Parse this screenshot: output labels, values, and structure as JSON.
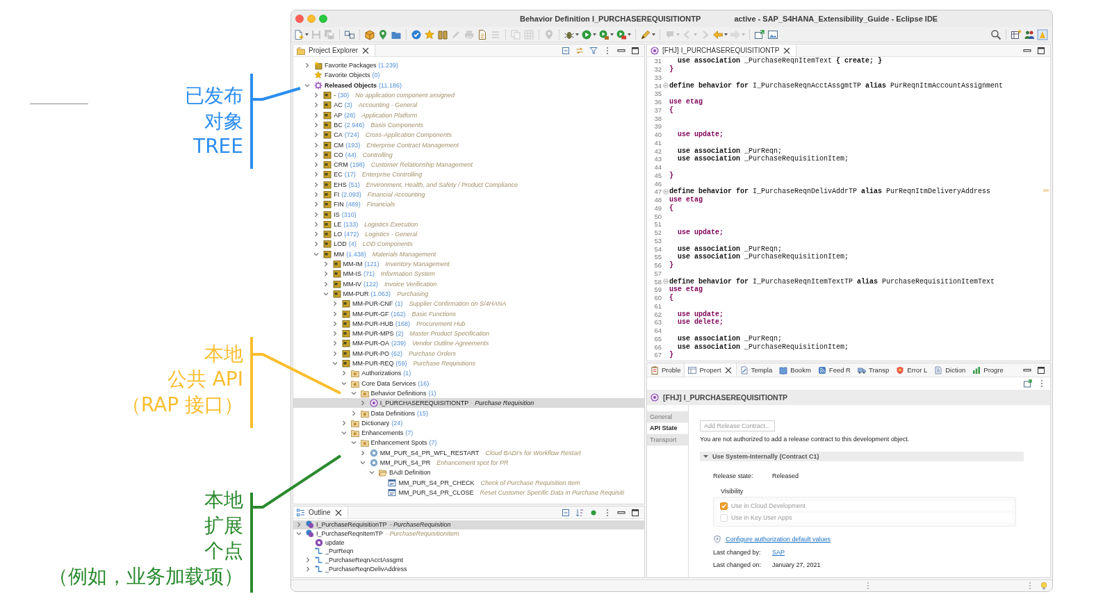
{
  "annotations": [
    {
      "lines": [
        "已发布",
        "对象",
        "TREE"
      ],
      "color": "#2a8df0"
    },
    {
      "lines": [
        "本地",
        "公共 API",
        "（RAP 接口）"
      ],
      "color": "#fbbd2d"
    },
    {
      "lines": [
        "本地",
        "扩展",
        "个点",
        "（例如，业务加载项）"
      ],
      "color": "#2a8a2e"
    }
  ],
  "window": {
    "title": "Behavior Definition I_PURCHASEREQUISITIONTP",
    "context": "active - SAP_S4HANA_Extensibility_Guide - Eclipse IDE"
  },
  "toolbar": {
    "groups": [
      [
        {
          "kind": "new",
          "dropdown": true,
          "disabled": false
        },
        {
          "kind": "save",
          "disabled": true
        },
        {
          "kind": "saveall",
          "disabled": true
        }
      ],
      [
        {
          "kind": "connect",
          "disabled": false
        }
      ],
      [
        {
          "kind": "package",
          "disabled": false
        },
        {
          "kind": "pin",
          "disabled": false
        },
        {
          "kind": "folder",
          "disabled": false
        }
      ],
      [
        {
          "kind": "check",
          "disabled": false
        },
        {
          "kind": "star",
          "disabled": false
        },
        {
          "kind": "book",
          "disabled": false
        },
        {
          "kind": "pencil",
          "disabled": true
        },
        {
          "kind": "printer",
          "disabled": true
        },
        {
          "kind": "page",
          "disabled": false
        },
        {
          "kind": "list",
          "disabled": true
        }
      ],
      [
        {
          "kind": "copy",
          "disabled": true
        },
        {
          "kind": "grid",
          "disabled": true
        }
      ],
      [
        {
          "kind": "pin",
          "disabled": true
        }
      ],
      [
        {
          "kind": "bug",
          "dropdown": true,
          "disabled": false
        },
        {
          "kind": "run",
          "dropdown": true,
          "disabled": false
        },
        {
          "kind": "runext",
          "dropdown": true,
          "disabled": false
        },
        {
          "kind": "stop",
          "dropdown": true,
          "disabled": false
        }
      ],
      [
        {
          "kind": "pen",
          "dropdown": true,
          "disabled": false
        }
      ],
      [
        {
          "kind": "comment",
          "dropdown": true,
          "disabled": true
        },
        {
          "kind": "prev",
          "dropdown": true,
          "disabled": true
        },
        {
          "kind": "next",
          "disabled": true
        },
        {
          "kind": "back",
          "dropdown": true,
          "disabled": false
        },
        {
          "kind": "forward",
          "dropdown": true,
          "disabled": true
        }
      ],
      [
        {
          "kind": "window",
          "disabled": false
        },
        {
          "kind": "image",
          "disabled": false
        }
      ]
    ],
    "right": [
      [
        {
          "kind": "search",
          "disabled": false
        }
      ],
      [
        {
          "kind": "tableplus",
          "disabled": false
        },
        {
          "kind": "people",
          "disabled": false
        },
        {
          "kind": "tile",
          "disabled": false
        }
      ]
    ]
  },
  "explorer": {
    "title": "Project Explorer",
    "tree": [
      {
        "name": "Favorite Packages",
        "count": "(1.239)",
        "kind": "favorites",
        "expanded": false,
        "selected": false
      },
      {
        "name": "Favorite Objects",
        "count": "(0)",
        "kind": "star",
        "selected": false
      },
      {
        "name": "Released Objects",
        "count": "(11.186)",
        "kind": "released",
        "expanded": true,
        "selected": false,
        "children": [
          {
            "name": "-",
            "count": "(30)",
            "description": "No application component assigned",
            "kind": "package",
            "expanded": false,
            "selected": false
          },
          {
            "name": "AC",
            "count": "(3)",
            "description": "Accounting - General",
            "kind": "package",
            "expanded": false,
            "selected": false
          },
          {
            "name": "AP",
            "count": "(28)",
            "description": "Application Platform",
            "kind": "package",
            "expanded": false,
            "selected": false
          },
          {
            "name": "BC",
            "count": "(2.946)",
            "description": "Basis Components",
            "kind": "package",
            "expanded": false,
            "selected": false
          },
          {
            "name": "CA",
            "count": "(724)",
            "description": "Cross-Application Components",
            "kind": "package",
            "expanded": false,
            "selected": false
          },
          {
            "name": "CM",
            "count": "(193)",
            "description": "Enterprise Contract Management",
            "kind": "package",
            "expanded": false,
            "selected": false
          },
          {
            "name": "CO",
            "count": "(44)",
            "description": "Controlling",
            "kind": "package",
            "expanded": false,
            "selected": false
          },
          {
            "name": "CRM",
            "count": "(198)",
            "description": "Customer Relationship Management",
            "kind": "package",
            "expanded": false,
            "selected": false
          },
          {
            "name": "EC",
            "count": "(17)",
            "description": "Enterprise Controlling",
            "kind": "package",
            "expanded": false,
            "selected": false
          },
          {
            "name": "EHS",
            "count": "(51)",
            "description": "Environment, Health, and Safety / Product Compliance",
            "kind": "package",
            "expanded": false,
            "selected": false
          },
          {
            "name": "FI",
            "count": "(2.093)",
            "description": "Financial Accounting",
            "kind": "package",
            "expanded": false,
            "selected": false
          },
          {
            "name": "FIN",
            "count": "(489)",
            "description": "Financials",
            "kind": "package",
            "expanded": false,
            "selected": false
          },
          {
            "name": "IS",
            "count": "(310)",
            "kind": "package",
            "expanded": false,
            "selected": false
          },
          {
            "name": "LE",
            "count": "(133)",
            "description": "Logistics Execution",
            "kind": "package",
            "expanded": false,
            "selected": false
          },
          {
            "name": "LO",
            "count": "(472)",
            "description": "Logistics - General",
            "kind": "package",
            "expanded": false,
            "selected": false
          },
          {
            "name": "LOD",
            "count": "(4)",
            "description": "LOD Components",
            "kind": "package",
            "expanded": false,
            "selected": false
          },
          {
            "name": "MM",
            "count": "(1.438)",
            "description": "Materials Management",
            "kind": "package",
            "expanded": true,
            "selected": false,
            "children": [
              {
                "name": "MM-IM",
                "count": "(121)",
                "description": "Inventory Management",
                "kind": "package",
                "expanded": false,
                "selected": false
              },
              {
                "name": "MM-IS",
                "count": "(71)",
                "description": "Information System",
                "kind": "package",
                "expanded": false,
                "selected": false
              },
              {
                "name": "MM-IV",
                "count": "(122)",
                "description": "Invoice Verification",
                "kind": "package",
                "expanded": false,
                "selected": false
              },
              {
                "name": "MM-PUR",
                "count": "(1.063)",
                "description": "Purchasing",
                "kind": "package",
                "expanded": true,
                "selected": false,
                "children": [
                  {
                    "name": "MM-PUR-CNF",
                    "count": "(1)",
                    "description": "Supplier Confirmation on S/4HANA",
                    "kind": "package",
                    "expanded": false,
                    "selected": false
                  },
                  {
                    "name": "MM-PUR-GF",
                    "count": "(162)",
                    "description": "Basic Functions",
                    "kind": "package",
                    "expanded": false,
                    "selected": false
                  },
                  {
                    "name": "MM-PUR-HUB",
                    "count": "(168)",
                    "description": "Procurement Hub",
                    "kind": "package",
                    "expanded": false,
                    "selected": false
                  },
                  {
                    "name": "MM-PUR-MPS",
                    "count": "(2)",
                    "description": "Master Product Specification",
                    "kind": "package",
                    "expanded": false,
                    "selected": false
                  },
                  {
                    "name": "MM-PUR-OA",
                    "count": "(239)",
                    "description": "Vendor Outline Agreements",
                    "kind": "package",
                    "expanded": false,
                    "selected": false
                  },
                  {
                    "name": "MM-PUR-PO",
                    "count": "(62)",
                    "description": "Purchase Orders",
                    "kind": "package",
                    "expanded": false,
                    "selected": false
                  },
                  {
                    "name": "MM-PUR-REQ",
                    "count": "(59)",
                    "description": "Purchase Requisitions",
                    "kind": "package",
                    "expanded": true,
                    "selected": false,
                    "children": [
                      {
                        "name": "Authorizations",
                        "count": "(1)",
                        "kind": "folder",
                        "expanded": false,
                        "selected": false
                      },
                      {
                        "name": "Core Data Services",
                        "count": "(16)",
                        "kind": "folder",
                        "expanded": true,
                        "selected": false,
                        "children": [
                          {
                            "name": "Behavior Definitions",
                            "count": "(1)",
                            "kind": "folder",
                            "expanded": true,
                            "selected": false,
                            "children": [
                              {
                                "name": "I_PURCHASEREQUISITIONTP",
                                "description": "Purchase Requisition",
                                "kind": "bdef",
                                "expanded": false,
                                "selected": true
                              }
                            ]
                          },
                          {
                            "name": "Data Definitions",
                            "count": "(15)",
                            "kind": "folder",
                            "expanded": false,
                            "selected": false
                          }
                        ]
                      },
                      {
                        "name": "Dictionary",
                        "count": "(24)",
                        "kind": "folder",
                        "expanded": false,
                        "selected": false
                      },
                      {
                        "name": "Enhancements",
                        "count": "(7)",
                        "kind": "folder",
                        "expanded": true,
                        "selected": false,
                        "children": [
                          {
                            "name": "Enhancement Spots",
                            "count": "(7)",
                            "kind": "folder",
                            "expanded": true,
                            "selected": false,
                            "children": [
                              {
                                "name": "MM_PUR_S4_PR_WFL_RESTART",
                                "description": "Cloud BADI's for Workflow Restart",
                                "kind": "spot",
                                "expanded": false,
                                "selected": false
                              },
                              {
                                "name": "MM_PUR_S4_PR",
                                "description": "Enhancement spot for PR",
                                "kind": "spot",
                                "expanded": true,
                                "selected": false,
                                "children": [
                                  {
                                    "name": "BAdI Definition",
                                    "kind": "badifolder",
                                    "expanded": true,
                                    "selected": false,
                                    "children": [
                                      {
                                        "name": "MM_PUR_S4_PR_CHECK",
                                        "description": "Check of Purchase Requisition Item",
                                        "kind": "badi",
                                        "selected": false
                                      },
                                      {
                                        "name": "MM_PUR_S4_PR_CLOSE",
                                        "description": "Reset Customer Specific Data in Purchase Requisiti",
                                        "kind": "badi",
                                        "selected": false
                                      }
                                    ]
                                  }
                                ]
                              }
                            ]
                          }
                        ]
                      }
                    ]
                  }
                ]
              }
            ]
          }
        ]
      }
    ]
  },
  "outline": {
    "title": "Outline",
    "items": [
      {
        "name": "I_PurchaseRequisitionTP",
        "description": "- PurchaseRequisition",
        "kind": "entity",
        "expanded": false,
        "selected": true
      },
      {
        "name": "I_PurchaseReqnItemTP",
        "description": "- PurchaseRequisitionItem",
        "kind": "entity",
        "expanded": true,
        "selected": false,
        "children": [
          {
            "name": "update",
            "kind": "action",
            "selected": false
          },
          {
            "name": "_PurReqn",
            "kind": "association",
            "selected": false
          },
          {
            "name": "_PurchaseReqnAcctAssgmt",
            "kind": "association",
            "expanded": false,
            "selected": false
          },
          {
            "name": "_PurchaseReqnDelivAddress",
            "kind": "association",
            "expanded": false,
            "selected": false
          }
        ]
      }
    ]
  },
  "editor": {
    "tab": "[FHJ] I_PURCHASEREQUISITIONTP",
    "lines": [
      {
        "number": "31",
        "kind": "code",
        "text": "  **use association** _PurchaseReqnItemText **{ create; }**"
      },
      {
        "number": "32",
        "kind": "keyword",
        "text": "}"
      },
      {
        "number": "33",
        "kind": "blank"
      },
      {
        "number": "34",
        "kind": "header",
        "text": "**define behavior for** I_PurchaseReqnAcctAssgmtTP **alias** PurReqnItmAccountAssignment"
      },
      {
        "number": "35",
        "kind": "blank"
      },
      {
        "number": "36",
        "kind": "keyword",
        "text": "use etag"
      },
      {
        "number": "37",
        "kind": "keyword",
        "text": "{"
      },
      {
        "number": "38",
        "kind": "blank"
      },
      {
        "number": "39",
        "kind": "blank"
      },
      {
        "number": "40",
        "kind": "keyword",
        "text": "  use update;"
      },
      {
        "number": "41",
        "kind": "blank"
      },
      {
        "number": "42",
        "kind": "code",
        "text": "  **use association** _PurReqn;"
      },
      {
        "number": "43",
        "kind": "code",
        "text": "  **use association** _PurchaseRequisitionItem;"
      },
      {
        "number": "44",
        "kind": "blank"
      },
      {
        "number": "45",
        "kind": "keyword",
        "text": "}"
      },
      {
        "number": "46",
        "kind": "blank"
      },
      {
        "number": "47",
        "kind": "header",
        "text": "**define behavior for** I_PurchaseReqnDelivAddrTP **alias** PurReqnItmDeliveryAddress"
      },
      {
        "number": "48",
        "kind": "keyword",
        "text": "use etag"
      },
      {
        "number": "49",
        "kind": "keyword",
        "text": "{"
      },
      {
        "number": "50",
        "kind": "blank"
      },
      {
        "number": "51",
        "kind": "blank"
      },
      {
        "number": "52",
        "kind": "keyword",
        "text": "  use update;"
      },
      {
        "number": "53",
        "kind": "blank"
      },
      {
        "number": "54",
        "kind": "code",
        "text": "  **use association** _PurReqn;"
      },
      {
        "number": "55",
        "kind": "code",
        "text": "  **use association** _PurchaseRequisitionItem;"
      },
      {
        "number": "56",
        "kind": "keyword",
        "text": "}"
      },
      {
        "number": "57",
        "kind": "blank"
      },
      {
        "number": "58",
        "kind": "header",
        "text": "**define behavior for** I_PurchaseReqnItemTextTP **alias** PurchaseRequisitionItemText"
      },
      {
        "number": "59",
        "kind": "keyword",
        "text": "use etag"
      },
      {
        "number": "60",
        "kind": "keyword",
        "text": "{"
      },
      {
        "number": "61",
        "kind": "blank"
      },
      {
        "number": "62",
        "kind": "keyword",
        "text": "  use update;"
      },
      {
        "number": "63",
        "kind": "keyword",
        "text": "  use delete;"
      },
      {
        "number": "64",
        "kind": "blank"
      },
      {
        "number": "65",
        "kind": "code",
        "text": "  **use association** _PurReqn;"
      },
      {
        "number": "66",
        "kind": "code",
        "text": "  **use association** _PurchaseRequisitionItem;"
      },
      {
        "number": "67",
        "kind": "keyword",
        "text": "}"
      }
    ]
  },
  "views": {
    "tabs": [
      {
        "label": "Proble",
        "kind": "problems",
        "selected": false
      },
      {
        "label": "Propert",
        "kind": "properties",
        "selected": true
      },
      {
        "label": "Templa",
        "kind": "templates",
        "selected": false
      },
      {
        "label": "Bookm",
        "kind": "bookmarks",
        "selected": false
      },
      {
        "label": "Feed R",
        "kind": "feed",
        "selected": false
      },
      {
        "label": "Transp",
        "kind": "transport",
        "selected": false
      },
      {
        "label": "Error L",
        "kind": "errors",
        "selected": false
      },
      {
        "label": "Diction",
        "kind": "dictionary",
        "selected": false
      },
      {
        "label": "Progre",
        "kind": "progress",
        "selected": false
      }
    ],
    "properties": {
      "title": "[FHJ] I_PURCHASEREQUISITIONTP",
      "side_tabs": [
        {
          "label": "General",
          "selected": false
        },
        {
          "label": "API State",
          "selected": true
        },
        {
          "label": "Transport",
          "selected": false
        }
      ],
      "add_button": {
        "label": "Add Release Contract...",
        "disabled": true
      },
      "message": "You are not authorized to add a release contract to this development object.",
      "section": {
        "title": "Use System-Internally (Contract C1)",
        "expanded": true,
        "release_state": {
          "label": "Release state:",
          "value": "Released"
        },
        "visibility": {
          "title": "Visibility",
          "options": [
            {
              "label": "Use in Cloud Development",
              "checked": true,
              "disabled": true
            },
            {
              "label": "Use in Key User Apps",
              "checked": false,
              "disabled": true
            }
          ]
        },
        "link": "Configure authorization default values",
        "changed": [
          {
            "label": "Last changed by:",
            "value": "SAP",
            "kind": "link"
          },
          {
            "label": "Last changed on:",
            "value": "January 27, 2021",
            "kind": "text"
          }
        ]
      }
    }
  }
}
